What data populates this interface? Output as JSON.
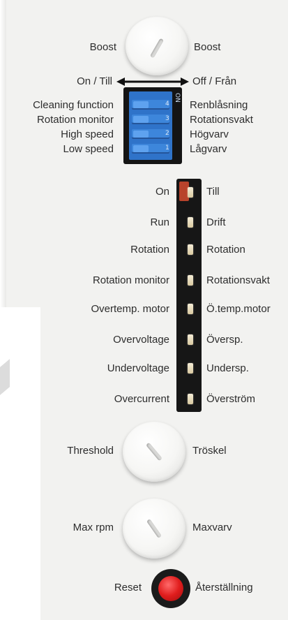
{
  "boost": {
    "left_label": "Boost",
    "right_label": "Boost"
  },
  "direction": {
    "left_label": "On / Till",
    "right_label": "Off / Från"
  },
  "dip_switch": {
    "left_labels": [
      "Cleaning function",
      "Rotation monitor",
      "High speed",
      "Low speed"
    ],
    "right_labels": [
      "Renblåsning",
      "Rotationsvakt",
      "Högvarv",
      "Lågvarv"
    ],
    "numbers": [
      "4",
      "3",
      "2",
      "1"
    ],
    "on_mark": "ON"
  },
  "indicators": [
    {
      "left": "On",
      "right": "Till",
      "lit": true
    },
    {
      "left": "Run",
      "right": "Drift",
      "lit": false
    },
    {
      "left": "Rotation",
      "right": "Rotation",
      "lit": false
    },
    {
      "left": "Rotation monitor",
      "right": "Rotationsvakt",
      "lit": false
    },
    {
      "left": "Overtemp. motor",
      "right": "Ö.temp.motor",
      "lit": false
    },
    {
      "left": "Overvoltage",
      "right": "Översp.",
      "lit": false
    },
    {
      "left": "Undervoltage",
      "right": "Undersp.",
      "lit": false
    },
    {
      "left": "Overcurrent",
      "right": "Överström",
      "lit": false
    }
  ],
  "threshold": {
    "left_label": "Threshold",
    "right_label": "Tröskel"
  },
  "max_rpm": {
    "left_label": "Max rpm",
    "right_label": "Maxvarv"
  },
  "reset": {
    "left_label": "Reset",
    "right_label": "Återställning",
    "color": "#e01d1d"
  },
  "colors": {
    "panel": "#f2f2f0",
    "dip_blue": "#2f73c9",
    "led_on": "#b8432b"
  }
}
